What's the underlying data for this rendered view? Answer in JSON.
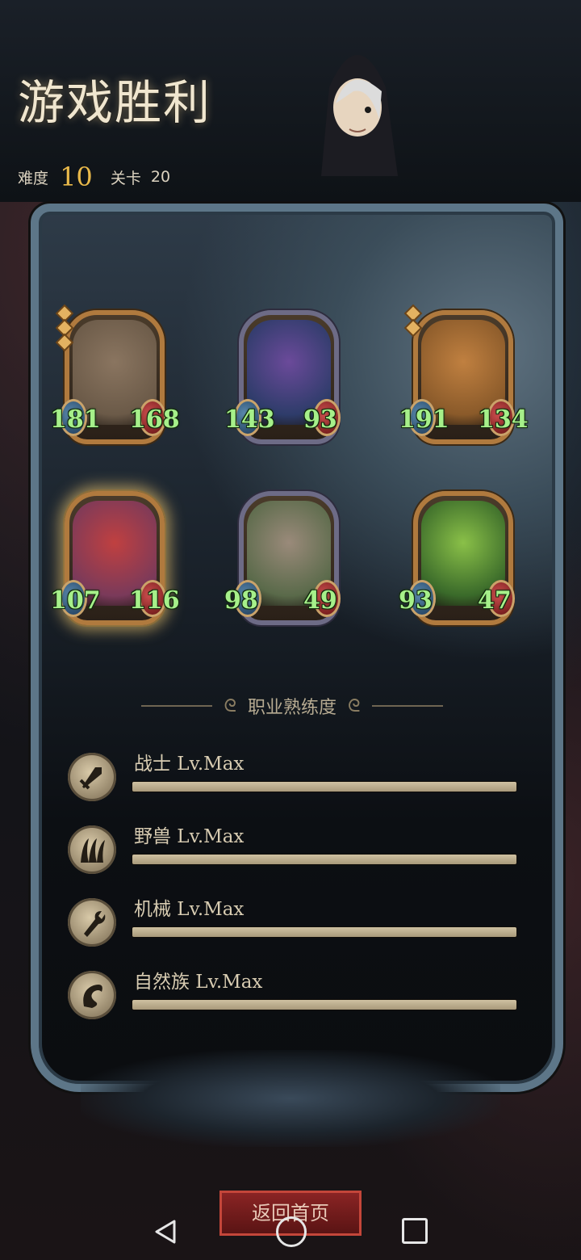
{
  "header": {
    "title": "游戏胜利",
    "difficulty_label": "难度",
    "difficulty_value": "10",
    "stage_label": "关卡",
    "stage_value": "20"
  },
  "cards": [
    {
      "atk": "181",
      "hp": "168",
      "frame": "gold",
      "pips": 3,
      "art": "ogre-portrait"
    },
    {
      "atk": "143",
      "hp": "93",
      "frame": "silver",
      "pips": 0,
      "art": "siren-portrait"
    },
    {
      "atk": "191",
      "hp": "134",
      "frame": "gold",
      "pips": 2,
      "art": "bear-portrait"
    },
    {
      "atk": "107",
      "hp": "116",
      "frame": "gold-glow",
      "pips": 0,
      "art": "dwarf-portrait"
    },
    {
      "atk": "98",
      "hp": "49",
      "frame": "silver",
      "pips": 0,
      "art": "slug-portrait"
    },
    {
      "atk": "93",
      "hp": "47",
      "frame": "gold",
      "pips": 0,
      "art": "dryad-portrait"
    }
  ],
  "mastery": {
    "title": "职业熟练度",
    "rows": [
      {
        "label": "战士 Lv.Max",
        "icon": "sword-icon",
        "progress": 1.0
      },
      {
        "label": "野兽 Lv.Max",
        "icon": "claw-icon",
        "progress": 1.0
      },
      {
        "label": "机械 Lv.Max",
        "icon": "wrench-icon",
        "progress": 1.0
      },
      {
        "label": "自然族 Lv.Max",
        "icon": "leaf-icon",
        "progress": 1.0
      }
    ]
  },
  "return_button": "返回首页",
  "colors": {
    "stat_text": "#a6f08a",
    "difficulty": "#e9b94a",
    "gold_frame": "#b07a3e",
    "silver_frame": "#6d6b86"
  }
}
